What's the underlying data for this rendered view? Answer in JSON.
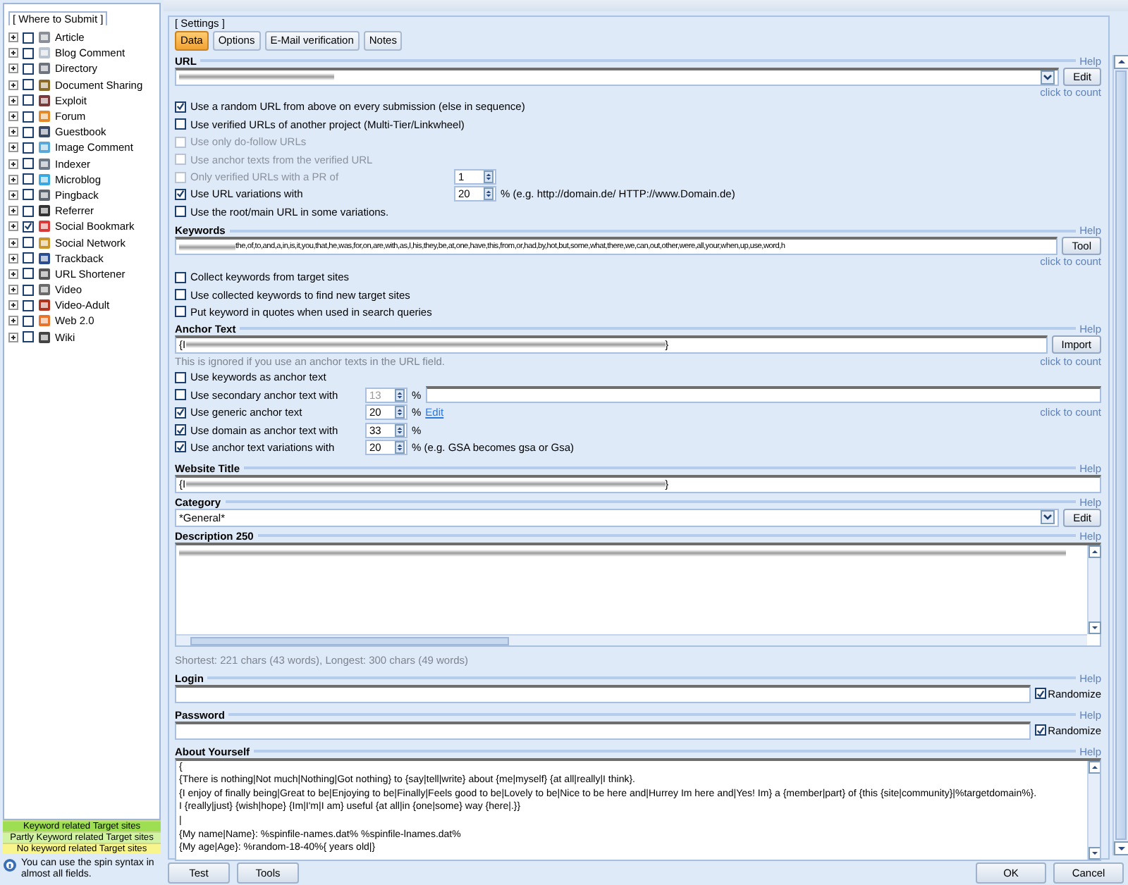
{
  "sidebar": {
    "title": "[ Where to Submit ]",
    "items": [
      {
        "label": "Article",
        "checked": false
      },
      {
        "label": "Blog Comment",
        "checked": false
      },
      {
        "label": "Directory",
        "checked": false
      },
      {
        "label": "Document Sharing",
        "checked": false
      },
      {
        "label": "Exploit",
        "checked": false
      },
      {
        "label": "Forum",
        "checked": false
      },
      {
        "label": "Guestbook",
        "checked": false
      },
      {
        "label": "Image Comment",
        "checked": false
      },
      {
        "label": "Indexer",
        "checked": false
      },
      {
        "label": "Microblog",
        "checked": false
      },
      {
        "label": "Pingback",
        "checked": false
      },
      {
        "label": "Referrer",
        "checked": false
      },
      {
        "label": "Social Bookmark",
        "checked": true
      },
      {
        "label": "Social Network",
        "checked": false
      },
      {
        "label": "Trackback",
        "checked": false
      },
      {
        "label": "URL Shortener",
        "checked": false
      },
      {
        "label": "Video",
        "checked": false
      },
      {
        "label": "Video-Adult",
        "checked": false
      },
      {
        "label": "Web 2.0",
        "checked": false
      },
      {
        "label": "Wiki",
        "checked": false
      }
    ]
  },
  "legend": [
    {
      "label": "Keyword related Target sites",
      "color": "#9ede52"
    },
    {
      "label": "Partly Keyword related Target sites",
      "color": "#d2f2a4"
    },
    {
      "label": "No keyword related Target sites",
      "color": "#f7f58c"
    }
  ],
  "hint": "You can use the spin syntax in almost all fields.",
  "settings": {
    "title": "[ Settings ]",
    "tabs": [
      {
        "label": "Data",
        "selected": true
      },
      {
        "label": "Options",
        "selected": false
      },
      {
        "label": "E-Mail verification",
        "selected": false
      },
      {
        "label": "Notes",
        "selected": false
      }
    ],
    "url": {
      "label": "URL",
      "help": "Help",
      "redacted": true,
      "button": "Edit",
      "count": "click to count",
      "options": [
        {
          "label": "Use a random URL from above on every submission (else in sequence)",
          "checked": true,
          "disabled": false
        },
        {
          "label": "Use verified URLs of another project (Multi-Tier/Linkwheel)",
          "checked": false,
          "disabled": false
        },
        {
          "label": "Use only do-follow URLs",
          "checked": false,
          "disabled": true
        },
        {
          "label": "Use anchor texts from the verified URL",
          "checked": false,
          "disabled": true
        },
        {
          "label": "Only verified URLs with a PR of",
          "checked": false,
          "disabled": true,
          "spinner": {
            "value": "1",
            "disabled": false
          }
        },
        {
          "label": "Use URL variations with",
          "checked": true,
          "disabled": false,
          "spinner": {
            "value": "20",
            "disabled": false
          },
          "suffix": "% (e.g. http://domain.de/ HTTP://www.Domain.de)"
        },
        {
          "label": "Use the root/main URL in some variations.",
          "checked": false,
          "disabled": false
        }
      ]
    },
    "keywords": {
      "label": "Keywords",
      "help": "Help",
      "redacted": true,
      "value": "the,of,to,and,a,in,is,it,you,that,he,was,for,on,are,with,as,I,his,they,be,at,one,have,this,from,or,had,by,hot,but,some,what,there,we,can,out,other,were,all,your,when,up,use,word,h",
      "button": "Tool",
      "count": "click to count",
      "options": [
        {
          "label": "Collect keywords from target sites",
          "checked": false,
          "disabled": false
        },
        {
          "label": "Use collected keywords to find new target sites",
          "checked": false,
          "disabled": false
        },
        {
          "label": "Put keyword in quotes when used in search queries",
          "checked": false,
          "disabled": false
        }
      ]
    },
    "anchor_text": {
      "label": "Anchor Text",
      "help": "Help",
      "prefix": "{I",
      "redacted": true,
      "suffix": "}",
      "button": "Import",
      "note": "This is ignored if you use an anchor texts in the URL field.",
      "count": "click to count",
      "options": [
        {
          "label": "Use keywords as anchor text",
          "checked": false,
          "disabled": false
        },
        {
          "label": "Use secondary anchor text with",
          "checked": false,
          "disabled": false,
          "spinner": {
            "value": "13",
            "disabled": true
          },
          "suffix": "%",
          "text_field": true
        },
        {
          "label": "Use generic anchor text",
          "checked": true,
          "disabled": false,
          "spinner": {
            "value": "20",
            "disabled": false
          },
          "suffix": "%",
          "link": "Edit",
          "count": "click to count"
        },
        {
          "label": "Use domain as anchor text with",
          "checked": true,
          "disabled": false,
          "spinner": {
            "value": "33",
            "disabled": false
          },
          "suffix": "%"
        },
        {
          "label": "Use anchor text variations with",
          "checked": true,
          "disabled": false,
          "spinner": {
            "value": "20",
            "disabled": false
          },
          "suffix": "% (e.g. GSA becomes gsa or Gsa)"
        }
      ]
    },
    "website_title": {
      "label": "Website Title",
      "help": "Help",
      "prefix": "{I",
      "redacted": true,
      "suffix": "}"
    },
    "category": {
      "label": "Category",
      "help": "Help",
      "value": "*General*",
      "button": "Edit"
    },
    "description": {
      "label": "Description 250",
      "help": "Help",
      "redacted": true,
      "stats": "Shortest: 221 chars (43 words), Longest: 300 chars (49 words)"
    },
    "login": {
      "label": "Login",
      "help": "Help",
      "randomize": {
        "label": "Randomize",
        "checked": true
      }
    },
    "password": {
      "label": "Password",
      "help": "Help",
      "randomize": {
        "label": "Randomize",
        "checked": true
      }
    },
    "about": {
      "label": "About Yourself",
      "help": "Help",
      "lines": [
        "{",
        "{There is nothing|Not much|Nothing|Got nothing} to {say|tell|write} about {me|myself} {at all|really|I think}.",
        "{I enjoy of finally being|Great to be|Enjoying to be|Finally|Feels good to be|Lovely to be|Nice to be here and|Hurrey Im here and|Yes! Im} a {member|part} of {this {site|community}|%targetdomain%}.",
        "I {really|just} {wish|hope} {Im|I'm|I am} useful {at all|in {one|some} way {here|.}}",
        "|",
        "{My name|Name}: %spinfile-names.dat% %spinfile-lnames.dat%",
        "{My age|Age}: %random-18-40%{ years old|}"
      ]
    }
  },
  "footer": {
    "left_buttons": [
      "Test",
      "Tools"
    ],
    "right_buttons": [
      "OK",
      "Cancel"
    ]
  }
}
